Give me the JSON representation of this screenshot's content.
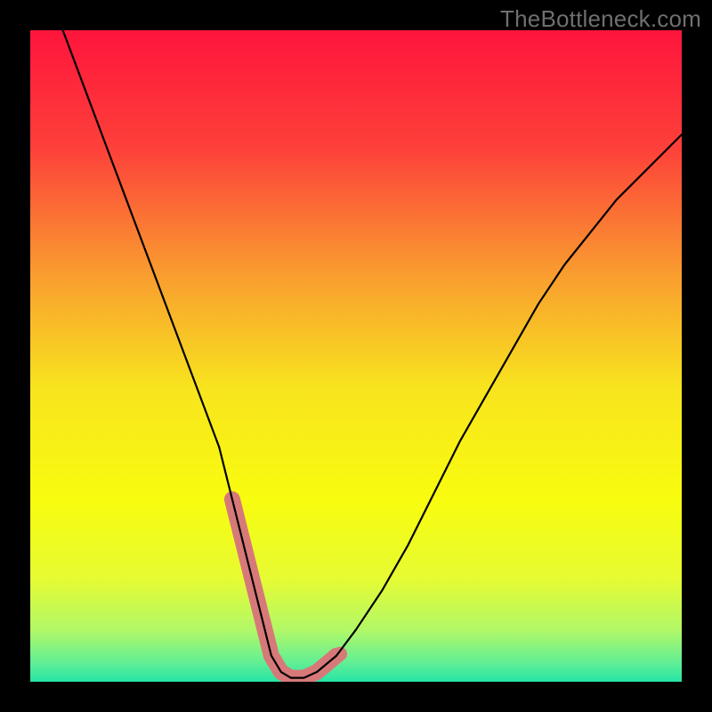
{
  "watermark": "TheBottleneck.com",
  "chart_data": {
    "type": "line",
    "title": "",
    "xlabel": "",
    "ylabel": "",
    "xlim": [
      0,
      100
    ],
    "ylim": [
      0,
      100
    ],
    "grid": false,
    "series": [
      {
        "name": "bottleneck-curve",
        "x": [
          5,
          8,
          11,
          14,
          17,
          20,
          23,
          26,
          29,
          31,
          33,
          34.5,
          36,
          37,
          38.5,
          40,
          42,
          44,
          47,
          50,
          54,
          58,
          62,
          66,
          70,
          74,
          78,
          82,
          86,
          90,
          94,
          98,
          100
        ],
        "y": [
          100,
          92,
          84,
          76,
          68,
          60,
          52,
          44,
          36,
          28,
          20,
          14,
          8,
          4,
          1.5,
          0.6,
          0.6,
          1.5,
          4,
          8,
          14,
          21,
          29,
          37,
          44,
          51,
          58,
          64,
          69,
          74,
          78,
          82,
          84
        ]
      }
    ],
    "highlight_zone": {
      "name": "optimal-zone",
      "color": "#d77979",
      "x": [
        31,
        33,
        34.5,
        36,
        37,
        38.5,
        40,
        42,
        44,
        47
      ],
      "y": [
        28,
        20,
        14,
        8,
        4,
        1.5,
        0.6,
        0.6,
        1.5,
        4
      ]
    },
    "background_gradient": {
      "stops": [
        {
          "offset": 0.0,
          "color": "#fe153c"
        },
        {
          "offset": 0.18,
          "color": "#fd403a"
        },
        {
          "offset": 0.38,
          "color": "#f99f2f"
        },
        {
          "offset": 0.55,
          "color": "#f8e41e"
        },
        {
          "offset": 0.72,
          "color": "#f8fc0e"
        },
        {
          "offset": 0.84,
          "color": "#e7fb32"
        },
        {
          "offset": 0.92,
          "color": "#b2f867"
        },
        {
          "offset": 0.97,
          "color": "#63ef94"
        },
        {
          "offset": 1.0,
          "color": "#26e4a6"
        }
      ]
    }
  }
}
